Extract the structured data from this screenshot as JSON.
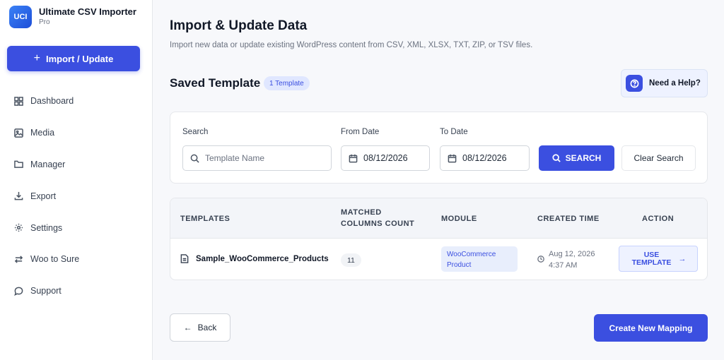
{
  "brand": {
    "logo_text": "UCI",
    "title": "Ultimate CSV Importer",
    "subtitle": "Pro"
  },
  "sidebar": {
    "import_button": {
      "label": "Import / Update",
      "icon": "plus-icon"
    },
    "items": [
      {
        "label": "Dashboard",
        "icon": "grid-icon"
      },
      {
        "label": "Media",
        "icon": "image-icon"
      },
      {
        "label": "Manager",
        "icon": "folder-icon"
      },
      {
        "label": "Export",
        "icon": "download-icon"
      },
      {
        "label": "Settings",
        "icon": "gear-icon"
      },
      {
        "label": "Woo to Sure",
        "icon": "swap-icon"
      },
      {
        "label": "Support",
        "icon": "chat-icon"
      }
    ]
  },
  "header": {
    "title": "Import & Update Data",
    "subtitle": "Import new data or update existing WordPress content from CSV, XML, XLSX, TXT, ZIP, or TSV files."
  },
  "saved": {
    "title": "Saved Template",
    "badge": "1 Template"
  },
  "help": {
    "label": "Need a Help?",
    "icon": "question-icon"
  },
  "search": {
    "search_label": "Search",
    "search_placeholder": "Template Name",
    "from_label": "From Date",
    "from_value": "08/12/2026",
    "to_label": "To Date",
    "to_value": "08/12/2026",
    "search_button": "SEARCH",
    "clear_button": "Clear Search"
  },
  "table": {
    "headers": {
      "templates": "TEMPLATES",
      "matched_1": "MATCHED",
      "matched_2": "COLUMNS COUNT",
      "module": "MODULE",
      "created": "CREATED TIME",
      "action": "ACTION"
    },
    "rows": [
      {
        "name": "Sample_WooCommerce_Products",
        "count": "11",
        "module_1": "WooCommerce",
        "module_2": "Product",
        "created_date": "Aug 12, 2026",
        "created_time": "4:37 AM",
        "action": "USE TEMPLATE"
      }
    ]
  },
  "footer": {
    "back": "Back",
    "create": "Create New Mapping"
  },
  "colors": {
    "primary": "#3b4fe0",
    "badge_bg": "#e0e7ff",
    "sidebar_bg": "#ffffff",
    "page_bg": "#f7f8fb"
  }
}
